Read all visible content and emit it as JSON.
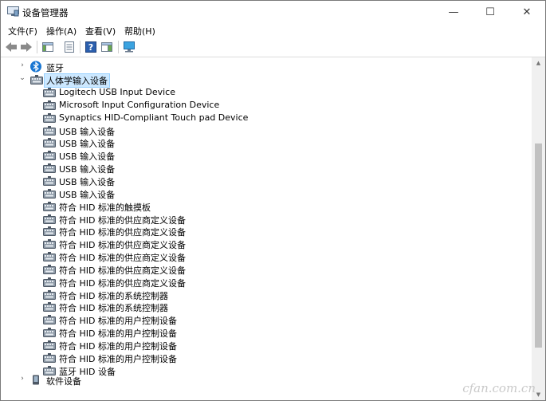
{
  "window": {
    "title": "设备管理器"
  },
  "caption": {
    "minimize": "—",
    "maximize": "☐",
    "close": "✕"
  },
  "menu": [
    "文件(F)",
    "操作(A)",
    "查看(V)",
    "帮助(H)"
  ],
  "toolbar": [
    "back-arrow",
    "forward-arrow",
    "show-hide-console-tree",
    "properties",
    "help",
    "action-pane",
    "monitor"
  ],
  "tree": {
    "bluetooth": {
      "label": "蓝牙",
      "expander": "›"
    },
    "hid": {
      "label": "人体学输入设备",
      "expander": "⌄"
    },
    "hid_devices": [
      "Logitech USB Input Device",
      "Microsoft Input Configuration Device",
      "Synaptics HID-Compliant Touch pad Device",
      "USB 输入设备",
      "USB 输入设备",
      "USB 输入设备",
      "USB 输入设备",
      "USB 输入设备",
      "USB 输入设备",
      "符合 HID 标准的触摸板",
      "符合 HID 标准的供应商定义设备",
      "符合 HID 标准的供应商定义设备",
      "符合 HID 标准的供应商定义设备",
      "符合 HID 标准的供应商定义设备",
      "符合 HID 标准的供应商定义设备",
      "符合 HID 标准的供应商定义设备",
      "符合 HID 标准的系统控制器",
      "符合 HID 标准的系统控制器",
      "符合 HID 标准的用户控制设备",
      "符合 HID 标准的用户控制设备",
      "符合 HID 标准的用户控制设备",
      "符合 HID 标准的用户控制设备",
      "蓝牙 HID 设备"
    ],
    "software": {
      "label": "软件设备",
      "expander": "›"
    }
  },
  "watermark": "cfan.com.cn",
  "colors": {
    "bluetooth": "#1976d2",
    "selection": "#cce8ff",
    "scroll_thumb": "#c1c1c1"
  }
}
